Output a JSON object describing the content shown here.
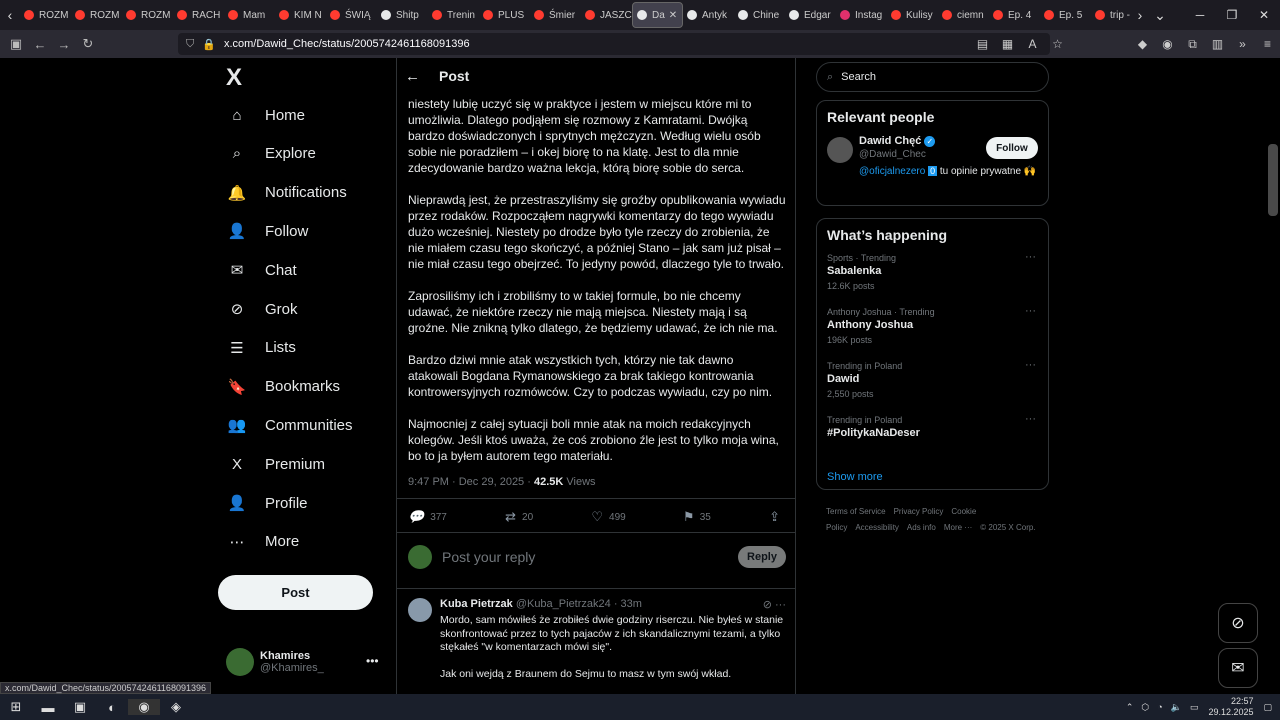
{
  "browser": {
    "tabs": [
      {
        "label": "ROZM",
        "color": "#ff3b30"
      },
      {
        "label": "ROZM",
        "color": "#ff3b30"
      },
      {
        "label": "ROZM",
        "color": "#ff3b30"
      },
      {
        "label": "RACH",
        "color": "#ff3b30"
      },
      {
        "label": "Mam",
        "color": "#ff3b30"
      },
      {
        "label": "KIM N",
        "color": "#ff3b30"
      },
      {
        "label": "ŚWIĄ",
        "color": "#ff3b30"
      },
      {
        "label": "Shitp",
        "color": "#e7e9ea"
      },
      {
        "label": "Trenin",
        "color": "#ff3b30"
      },
      {
        "label": "PLUS",
        "color": "#ff3b30"
      },
      {
        "label": "Śmier",
        "color": "#ff3b30"
      },
      {
        "label": "JASZC",
        "color": "#ff3b30"
      },
      {
        "label": "Da",
        "color": "#e7e9ea",
        "active": true
      },
      {
        "label": "Antyk",
        "color": "#e7e9ea"
      },
      {
        "label": "Chine",
        "color": "#e7e9ea"
      },
      {
        "label": "Edgar",
        "color": "#e7e9ea"
      },
      {
        "label": "Instag",
        "color": "#e1306c"
      },
      {
        "label": "Kulisy",
        "color": "#ff3b30"
      },
      {
        "label": "ciemn",
        "color": "#ff3b30"
      },
      {
        "label": "Ep. 4",
        "color": "#ff3b30"
      },
      {
        "label": "Ep. 5",
        "color": "#ff3b30"
      },
      {
        "label": "trip -",
        "color": "#ff3b30"
      }
    ],
    "url": "x.com/Dawid_Chec/status/2005742461168091396",
    "status_url": "x.com/Dawid_Chec/status/2005742461168091396"
  },
  "nav": {
    "logo": "X",
    "items": [
      {
        "label": "Home",
        "icon": "home-icon",
        "glyph": "⌂"
      },
      {
        "label": "Explore",
        "icon": "search-icon",
        "glyph": "⌕"
      },
      {
        "label": "Notifications",
        "icon": "bell-icon",
        "glyph": "🔔"
      },
      {
        "label": "Follow",
        "icon": "add-person-icon",
        "glyph": "👤"
      },
      {
        "label": "Chat",
        "icon": "mail-icon",
        "glyph": "✉"
      },
      {
        "label": "Grok",
        "icon": "grok-icon",
        "glyph": "⊘"
      },
      {
        "label": "Lists",
        "icon": "list-icon",
        "glyph": "☰"
      },
      {
        "label": "Bookmarks",
        "icon": "bookmark-icon",
        "glyph": "🔖"
      },
      {
        "label": "Communities",
        "icon": "people-icon",
        "glyph": "👥"
      },
      {
        "label": "Premium",
        "icon": "x-premium-icon",
        "glyph": "X"
      },
      {
        "label": "Profile",
        "icon": "person-icon",
        "glyph": "👤"
      },
      {
        "label": "More",
        "icon": "more-circle-icon",
        "glyph": "⋯"
      }
    ],
    "post_button": "Post",
    "account": {
      "name": "Khamires",
      "handle": "@Khamires_"
    }
  },
  "post": {
    "header_title": "Post",
    "paragraphs": [
      "niestety lubię uczyć się w praktyce i jestem w miejscu które mi to umożliwia. Dlatego podjąłem się rozmowy z Kamratami. Dwójką bardzo doświadczonych i sprytnych mężczyzn. Według wielu osób sobie nie poradziłem – i okej biorę to na klatę. Jest to dla mnie zdecydowanie bardzo ważna lekcja, którą biorę sobie do serca.",
      "Nieprawdą jest, że przestraszyliśmy się groźby opublikowania wywiadu przez rodaków. Rozpocząłem nagrywki komentarzy do tego wywiadu dużo wcześniej. Niestety po drodze było tyle rzeczy do zrobienia, że nie miałem czasu tego skończyć, a później Stano – jak sam już pisał – nie miał czasu tego obejrzeć. To jedyny powód, dlaczego tyle to trwało.",
      "Zaprosiliśmy ich i zrobiliśmy to w takiej formule, bo nie chcemy udawać, że niektóre rzeczy nie mają miejsca. Niestety mają i są groźne. Nie znikną tylko dlatego, że będziemy udawać, że ich nie ma.",
      "Bardzo dziwi mnie atak wszystkich tych, którzy nie tak dawno atakowali Bogdana Rymanowskiego za brak takiego kontrowania kontrowersyjnych rozmówców. Czy to podczas wywiadu, czy po nim.",
      "Najmocniej z całej sytuacji boli mnie atak na moich redakcyjnych kolegów. Jeśli ktoś uważa, że coś zrobiono źle jest to tylko moja wina, bo to ja byłem autorem tego materiału."
    ],
    "timestamp": "9:47 PM · Dec 29, 2025 · ",
    "views_count": "42.5K",
    "views_label": " Views",
    "replies": "377",
    "reposts": "20",
    "likes": "499",
    "bookmarks": "35",
    "reply_placeholder": "Post your reply",
    "reply_button": "Reply"
  },
  "comment": {
    "name": "Kuba Pietrzak",
    "handle": "@Kuba_Pietrzak24 · 33m",
    "lines": [
      "Mordo, sam mówiłeś że zrobiłeś dwie godziny riserczu. Nie byłeś w stanie skonfrontować przez to tych pajaców z ich skandalicznymi tezami, a tylko stękałeś \"w komentarzach mówi się\".",
      "Jak oni wejdą z Braunem do Sejmu to masz w tym swój wkład."
    ]
  },
  "sidebar": {
    "search_placeholder": "Search",
    "relevant_title": "Relevant people",
    "person": {
      "name": "Dawid Chęć",
      "handle": "@Dawid_Chec",
      "bio_link": "@oficjalnezero",
      "bio_badge": "0",
      "bio_rest": " tu opinie prywatne 🙌",
      "follow": "Follow"
    },
    "happening_title": "What’s happening",
    "trends": [
      {
        "context": "Sports · Trending",
        "name": "Sabalenka",
        "count": "12.6K posts"
      },
      {
        "context": "Anthony Joshua · Trending",
        "name": "Anthony Joshua",
        "count": "196K posts"
      },
      {
        "context": "Trending in Poland",
        "name": "Dawid",
        "count": "2,550 posts"
      },
      {
        "context": "Trending in Poland",
        "name": "#PolitykaNaDeser",
        "count": ""
      }
    ],
    "show_more": "Show more",
    "footer": [
      "Terms of Service",
      "Privacy Policy",
      "Cookie Policy",
      "Accessibility",
      "Ads info",
      "More ···",
      "© 2025 X Corp."
    ]
  },
  "taskbar": {
    "time": "22:57",
    "date": "29.12.2025"
  }
}
